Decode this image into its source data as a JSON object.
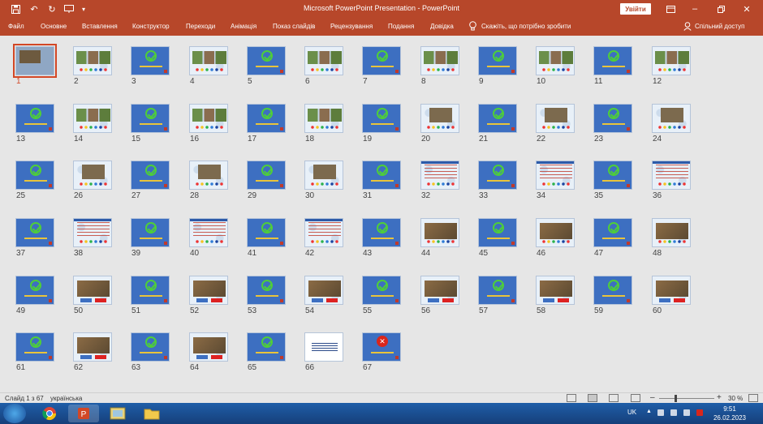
{
  "titlebar": {
    "app_title": "Microsoft PowerPoint Presentation  -  PowerPoint",
    "signin_label": "Увійти",
    "save_icon": "save-icon",
    "undo_icon": "undo-icon",
    "redo_icon": "redo-icon",
    "present_icon": "present-from-start-icon",
    "customize_icon": "customize-quick-access-icon",
    "ribbon_display_icon": "ribbon-display-options-icon",
    "minimize_icon": "minimize-icon",
    "maximize_icon": "restore-icon",
    "close_icon": "close-icon"
  },
  "ribbon": {
    "tabs": [
      "Файл",
      "Основне",
      "Вставлення",
      "Конструктор",
      "Переходи",
      "Анімація",
      "Показ слайдів",
      "Рецензування",
      "Подання",
      "Довідка"
    ],
    "tell_me": "Скажіть, що потрібно зробити",
    "share": "Спільний доступ"
  },
  "sorter": {
    "selected_slide": 1,
    "slides": [
      {
        "n": "1",
        "kind": "title"
      },
      {
        "n": "2",
        "kind": "photos"
      },
      {
        "n": "3",
        "kind": "check"
      },
      {
        "n": "4",
        "kind": "photos"
      },
      {
        "n": "5",
        "kind": "check"
      },
      {
        "n": "6",
        "kind": "photos"
      },
      {
        "n": "7",
        "kind": "check"
      },
      {
        "n": "8",
        "kind": "photos"
      },
      {
        "n": "9",
        "kind": "check"
      },
      {
        "n": "10",
        "kind": "photos"
      },
      {
        "n": "11",
        "kind": "check"
      },
      {
        "n": "12",
        "kind": "photos"
      },
      {
        "n": "13",
        "kind": "check"
      },
      {
        "n": "14",
        "kind": "photos"
      },
      {
        "n": "15",
        "kind": "check"
      },
      {
        "n": "16",
        "kind": "photos"
      },
      {
        "n": "17",
        "kind": "check"
      },
      {
        "n": "18",
        "kind": "photos"
      },
      {
        "n": "19",
        "kind": "check"
      },
      {
        "n": "20",
        "kind": "bird"
      },
      {
        "n": "21",
        "kind": "check"
      },
      {
        "n": "22",
        "kind": "bird"
      },
      {
        "n": "23",
        "kind": "check"
      },
      {
        "n": "24",
        "kind": "bird"
      },
      {
        "n": "25",
        "kind": "check"
      },
      {
        "n": "26",
        "kind": "bird"
      },
      {
        "n": "27",
        "kind": "check"
      },
      {
        "n": "28",
        "kind": "bird"
      },
      {
        "n": "29",
        "kind": "check"
      },
      {
        "n": "30",
        "kind": "bird"
      },
      {
        "n": "31",
        "kind": "check"
      },
      {
        "n": "32",
        "kind": "text"
      },
      {
        "n": "33",
        "kind": "check"
      },
      {
        "n": "34",
        "kind": "text"
      },
      {
        "n": "35",
        "kind": "check"
      },
      {
        "n": "36",
        "kind": "text"
      },
      {
        "n": "37",
        "kind": "check"
      },
      {
        "n": "38",
        "kind": "text"
      },
      {
        "n": "39",
        "kind": "check"
      },
      {
        "n": "40",
        "kind": "text"
      },
      {
        "n": "41",
        "kind": "check"
      },
      {
        "n": "42",
        "kind": "text"
      },
      {
        "n": "43",
        "kind": "check"
      },
      {
        "n": "44",
        "kind": "animal"
      },
      {
        "n": "45",
        "kind": "check"
      },
      {
        "n": "46",
        "kind": "animal"
      },
      {
        "n": "47",
        "kind": "check"
      },
      {
        "n": "48",
        "kind": "animal"
      },
      {
        "n": "49",
        "kind": "check"
      },
      {
        "n": "50",
        "kind": "animalbox"
      },
      {
        "n": "51",
        "kind": "check"
      },
      {
        "n": "52",
        "kind": "animalbox"
      },
      {
        "n": "53",
        "kind": "check"
      },
      {
        "n": "54",
        "kind": "animalbox"
      },
      {
        "n": "55",
        "kind": "check"
      },
      {
        "n": "56",
        "kind": "animalbox"
      },
      {
        "n": "57",
        "kind": "check"
      },
      {
        "n": "58",
        "kind": "animalbox"
      },
      {
        "n": "59",
        "kind": "check"
      },
      {
        "n": "60",
        "kind": "animalbox"
      },
      {
        "n": "61",
        "kind": "check"
      },
      {
        "n": "62",
        "kind": "animalbox"
      },
      {
        "n": "63",
        "kind": "check"
      },
      {
        "n": "64",
        "kind": "animalbox"
      },
      {
        "n": "65",
        "kind": "check"
      },
      {
        "n": "66",
        "kind": "white"
      },
      {
        "n": "67",
        "kind": "cross"
      }
    ]
  },
  "statusbar": {
    "slide_count": "Слайд 1 з 67",
    "language": "українська",
    "zoom": "30 %",
    "zoom_level": 0.3
  },
  "taskbar": {
    "apps": [
      "chrome-icon",
      "powerpoint-icon",
      "photo-viewer-icon",
      "file-explorer-icon"
    ],
    "kbd_lang": "UK",
    "time": "9:51",
    "date": "26.02.2023"
  }
}
